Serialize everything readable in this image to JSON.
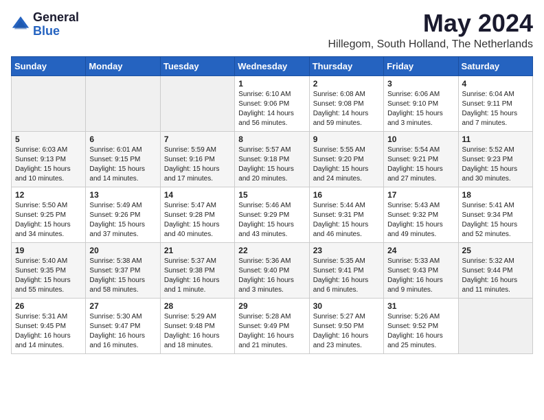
{
  "logo": {
    "general": "General",
    "blue": "Blue"
  },
  "title": "May 2024",
  "location": "Hillegom, South Holland, The Netherlands",
  "weekdays": [
    "Sunday",
    "Monday",
    "Tuesday",
    "Wednesday",
    "Thursday",
    "Friday",
    "Saturday"
  ],
  "weeks": [
    [
      {
        "day": "",
        "detail": ""
      },
      {
        "day": "",
        "detail": ""
      },
      {
        "day": "",
        "detail": ""
      },
      {
        "day": "1",
        "detail": "Sunrise: 6:10 AM\nSunset: 9:06 PM\nDaylight: 14 hours\nand 56 minutes."
      },
      {
        "day": "2",
        "detail": "Sunrise: 6:08 AM\nSunset: 9:08 PM\nDaylight: 14 hours\nand 59 minutes."
      },
      {
        "day": "3",
        "detail": "Sunrise: 6:06 AM\nSunset: 9:10 PM\nDaylight: 15 hours\nand 3 minutes."
      },
      {
        "day": "4",
        "detail": "Sunrise: 6:04 AM\nSunset: 9:11 PM\nDaylight: 15 hours\nand 7 minutes."
      }
    ],
    [
      {
        "day": "5",
        "detail": "Sunrise: 6:03 AM\nSunset: 9:13 PM\nDaylight: 15 hours\nand 10 minutes."
      },
      {
        "day": "6",
        "detail": "Sunrise: 6:01 AM\nSunset: 9:15 PM\nDaylight: 15 hours\nand 14 minutes."
      },
      {
        "day": "7",
        "detail": "Sunrise: 5:59 AM\nSunset: 9:16 PM\nDaylight: 15 hours\nand 17 minutes."
      },
      {
        "day": "8",
        "detail": "Sunrise: 5:57 AM\nSunset: 9:18 PM\nDaylight: 15 hours\nand 20 minutes."
      },
      {
        "day": "9",
        "detail": "Sunrise: 5:55 AM\nSunset: 9:20 PM\nDaylight: 15 hours\nand 24 minutes."
      },
      {
        "day": "10",
        "detail": "Sunrise: 5:54 AM\nSunset: 9:21 PM\nDaylight: 15 hours\nand 27 minutes."
      },
      {
        "day": "11",
        "detail": "Sunrise: 5:52 AM\nSunset: 9:23 PM\nDaylight: 15 hours\nand 30 minutes."
      }
    ],
    [
      {
        "day": "12",
        "detail": "Sunrise: 5:50 AM\nSunset: 9:25 PM\nDaylight: 15 hours\nand 34 minutes."
      },
      {
        "day": "13",
        "detail": "Sunrise: 5:49 AM\nSunset: 9:26 PM\nDaylight: 15 hours\nand 37 minutes."
      },
      {
        "day": "14",
        "detail": "Sunrise: 5:47 AM\nSunset: 9:28 PM\nDaylight: 15 hours\nand 40 minutes."
      },
      {
        "day": "15",
        "detail": "Sunrise: 5:46 AM\nSunset: 9:29 PM\nDaylight: 15 hours\nand 43 minutes."
      },
      {
        "day": "16",
        "detail": "Sunrise: 5:44 AM\nSunset: 9:31 PM\nDaylight: 15 hours\nand 46 minutes."
      },
      {
        "day": "17",
        "detail": "Sunrise: 5:43 AM\nSunset: 9:32 PM\nDaylight: 15 hours\nand 49 minutes."
      },
      {
        "day": "18",
        "detail": "Sunrise: 5:41 AM\nSunset: 9:34 PM\nDaylight: 15 hours\nand 52 minutes."
      }
    ],
    [
      {
        "day": "19",
        "detail": "Sunrise: 5:40 AM\nSunset: 9:35 PM\nDaylight: 15 hours\nand 55 minutes."
      },
      {
        "day": "20",
        "detail": "Sunrise: 5:38 AM\nSunset: 9:37 PM\nDaylight: 15 hours\nand 58 minutes."
      },
      {
        "day": "21",
        "detail": "Sunrise: 5:37 AM\nSunset: 9:38 PM\nDaylight: 16 hours\nand 1 minute."
      },
      {
        "day": "22",
        "detail": "Sunrise: 5:36 AM\nSunset: 9:40 PM\nDaylight: 16 hours\nand 3 minutes."
      },
      {
        "day": "23",
        "detail": "Sunrise: 5:35 AM\nSunset: 9:41 PM\nDaylight: 16 hours\nand 6 minutes."
      },
      {
        "day": "24",
        "detail": "Sunrise: 5:33 AM\nSunset: 9:43 PM\nDaylight: 16 hours\nand 9 minutes."
      },
      {
        "day": "25",
        "detail": "Sunrise: 5:32 AM\nSunset: 9:44 PM\nDaylight: 16 hours\nand 11 minutes."
      }
    ],
    [
      {
        "day": "26",
        "detail": "Sunrise: 5:31 AM\nSunset: 9:45 PM\nDaylight: 16 hours\nand 14 minutes."
      },
      {
        "day": "27",
        "detail": "Sunrise: 5:30 AM\nSunset: 9:47 PM\nDaylight: 16 hours\nand 16 minutes."
      },
      {
        "day": "28",
        "detail": "Sunrise: 5:29 AM\nSunset: 9:48 PM\nDaylight: 16 hours\nand 18 minutes."
      },
      {
        "day": "29",
        "detail": "Sunrise: 5:28 AM\nSunset: 9:49 PM\nDaylight: 16 hours\nand 21 minutes."
      },
      {
        "day": "30",
        "detail": "Sunrise: 5:27 AM\nSunset: 9:50 PM\nDaylight: 16 hours\nand 23 minutes."
      },
      {
        "day": "31",
        "detail": "Sunrise: 5:26 AM\nSunset: 9:52 PM\nDaylight: 16 hours\nand 25 minutes."
      },
      {
        "day": "",
        "detail": ""
      }
    ]
  ]
}
